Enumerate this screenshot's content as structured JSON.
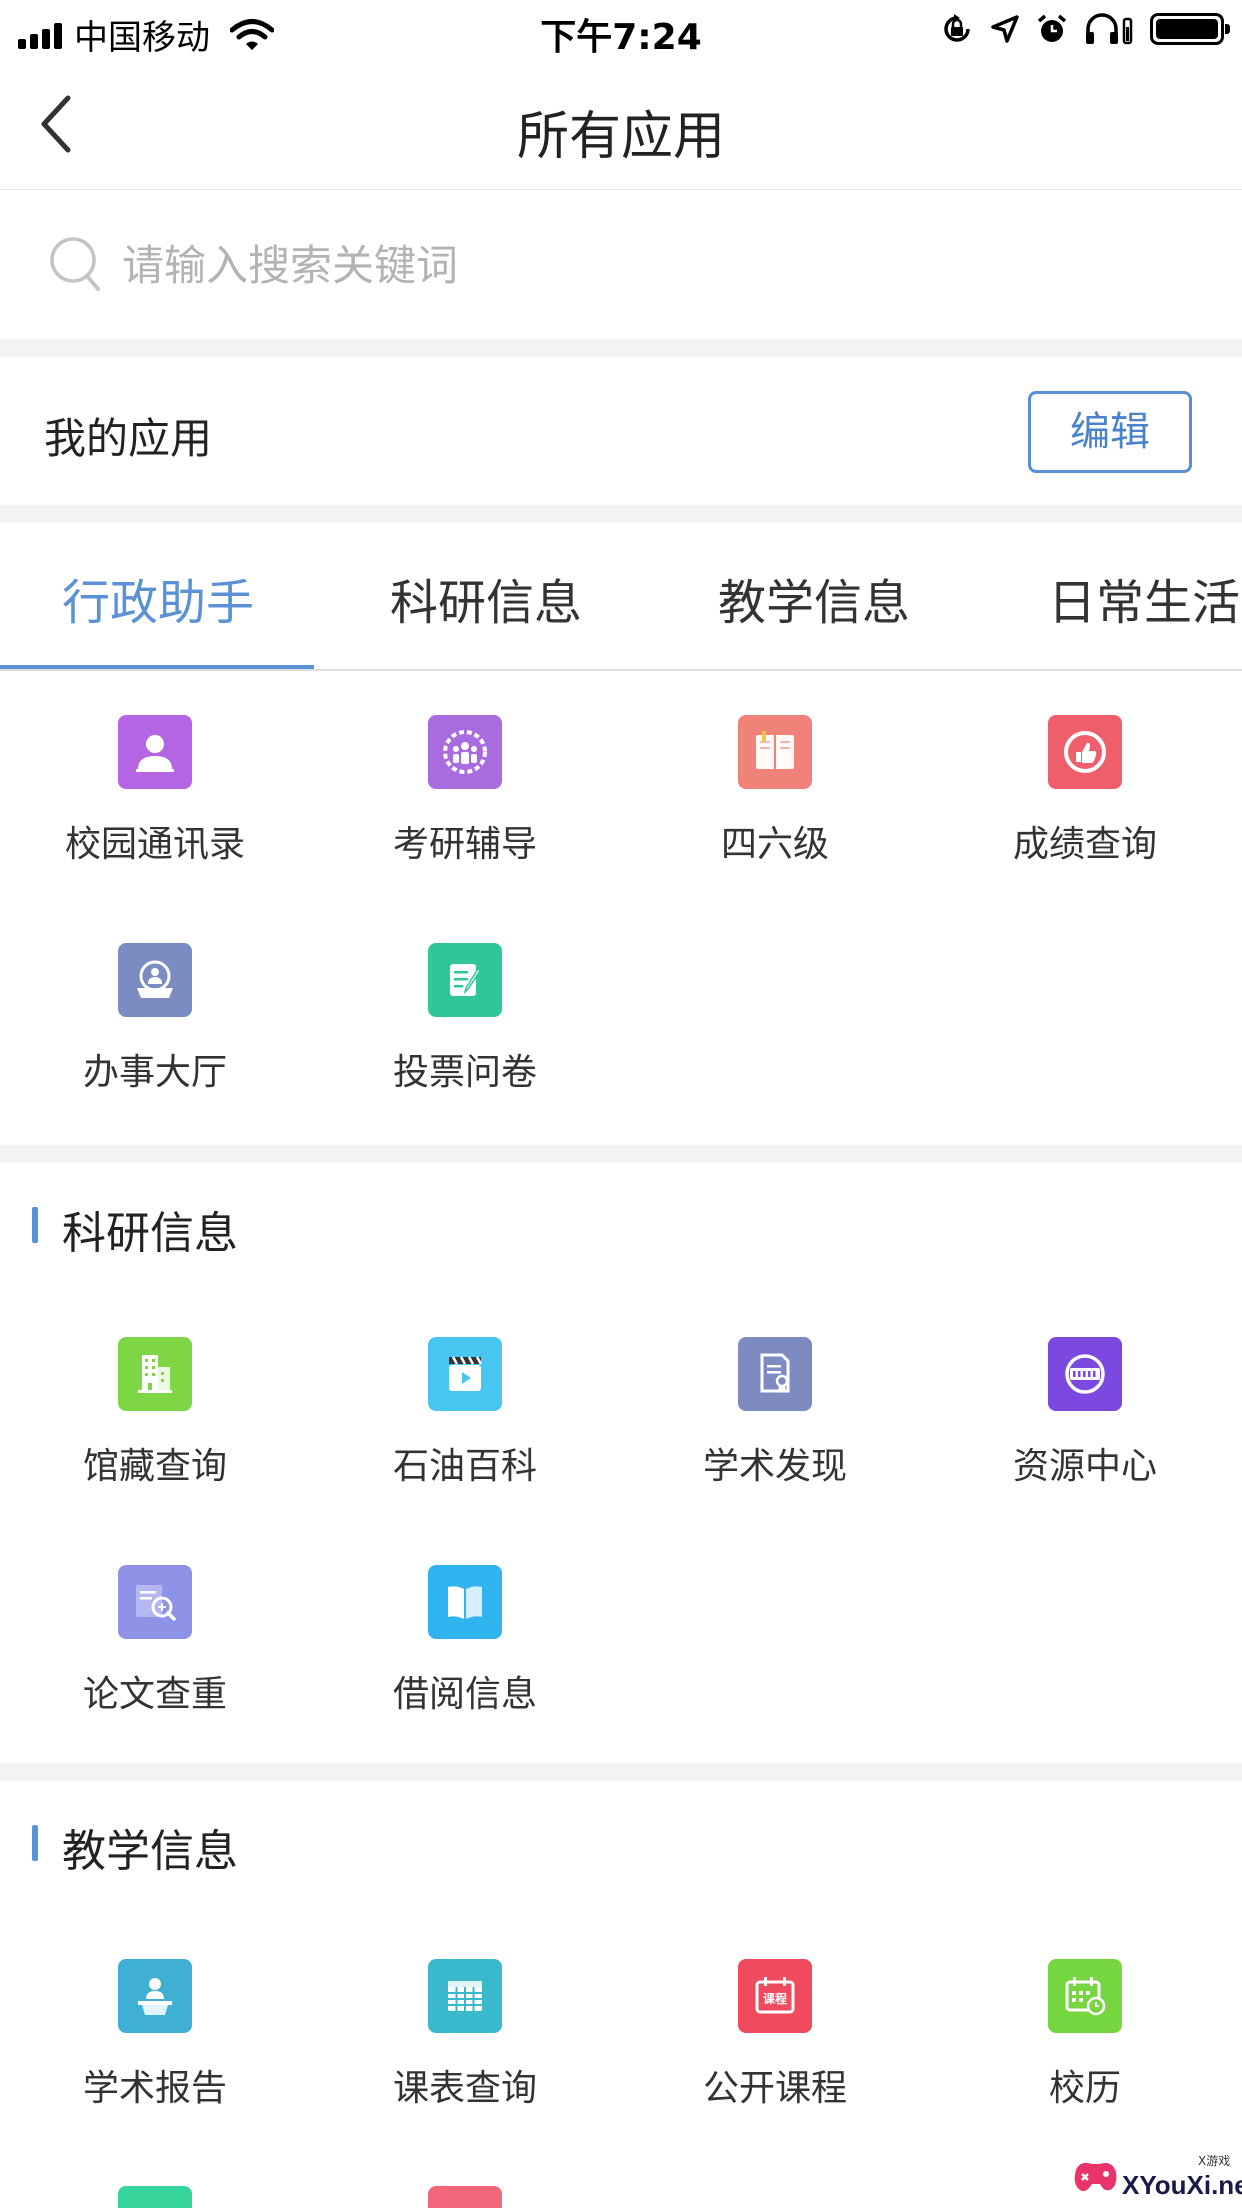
{
  "status_bar": {
    "carrier": "中国移动",
    "time": "下午7:24",
    "battery_percent": 100
  },
  "nav": {
    "title": "所有应用",
    "back_icon": "chevron-left-icon"
  },
  "search": {
    "placeholder": "请输入搜索关键词",
    "value": ""
  },
  "my_apps": {
    "title": "我的应用",
    "edit_label": "编辑"
  },
  "tabs": [
    {
      "label": "行政助手",
      "active": true
    },
    {
      "label": "科研信息",
      "active": false
    },
    {
      "label": "教学信息",
      "active": false
    },
    {
      "label": "日常生活",
      "active": false
    }
  ],
  "section_admin": {
    "apps": [
      {
        "label": "校园通讯录",
        "icon": "contact-person-icon",
        "color": "#b365e3"
      },
      {
        "label": "考研辅导",
        "icon": "people-gear-icon",
        "color": "#a96ce0"
      },
      {
        "label": "四六级",
        "icon": "open-book-icon",
        "color": "#f1827a"
      },
      {
        "label": "成绩查询",
        "icon": "thumbs-up-icon",
        "color": "#ef5f6b"
      },
      {
        "label": "办事大厅",
        "icon": "service-person-icon",
        "color": "#7a8cc2"
      },
      {
        "label": "投票问卷",
        "icon": "edit-note-icon",
        "color": "#2fc79a"
      }
    ]
  },
  "section_research": {
    "title": "科研信息",
    "apps": [
      {
        "label": "馆藏查询",
        "icon": "building-icon",
        "color": "#7fd645"
      },
      {
        "label": "石油百科",
        "icon": "video-clapper-icon",
        "color": "#47c7ef"
      },
      {
        "label": "学术发现",
        "icon": "certificate-doc-icon",
        "color": "#7e8bc0"
      },
      {
        "label": "资源中心",
        "icon": "storage-disc-icon",
        "color": "#7b48e0"
      },
      {
        "label": "论文查重",
        "icon": "doc-magnifier-icon",
        "color": "#8e93e8"
      },
      {
        "label": "借阅信息",
        "icon": "book-icon",
        "color": "#2fb4f0"
      }
    ]
  },
  "section_teaching": {
    "title": "教学信息",
    "apps": [
      {
        "label": "学术报告",
        "icon": "lecturer-icon",
        "color": "#3fb0d4"
      },
      {
        "label": "课表查询",
        "icon": "grid-table-icon",
        "color": "#3ab8cc"
      },
      {
        "label": "公开课程",
        "icon": "course-calendar-icon",
        "color": "#ef4a5e"
      },
      {
        "label": "校历",
        "icon": "calendar-clock-icon",
        "color": "#75d640"
      }
    ],
    "course_icon_text": "课程"
  },
  "watermark": {
    "text": "XYouXi.net",
    "small": "X游戏"
  }
}
